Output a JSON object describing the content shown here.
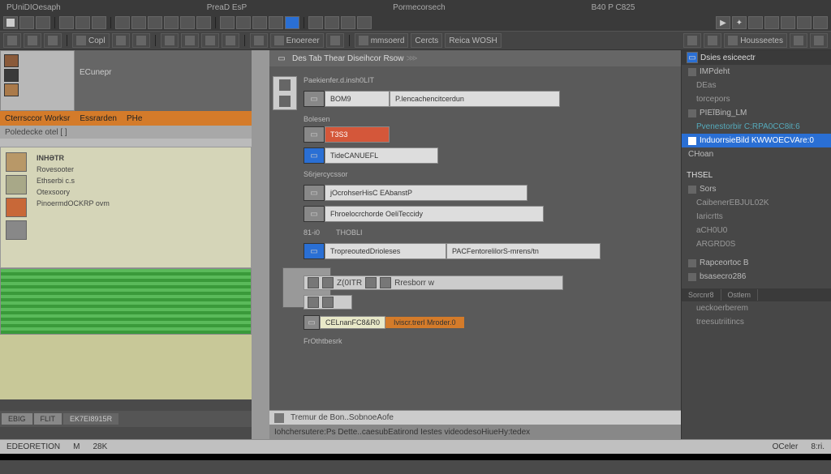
{
  "titlebar": {
    "app": "PUniDIOesaph",
    "mid": "PreaD EsP",
    "r1": "Pormecorsech",
    "r2": "B40 P C825"
  },
  "toolbar": {
    "copl": "Copl",
    "enoereer": "Enoereer",
    "mmsoerd": "mmsoerd",
    "cercts": "Cercts",
    "reica": "Reica WOSH",
    "housseetes": "Housseetes"
  },
  "left": {
    "panel2_title": "ECunepr",
    "orange": {
      "a": "Cterrsccor Worksr",
      "b": "Essrarden",
      "c": "PHe"
    },
    "gray": "Poledecke otel [ ]",
    "files": {
      "hdr": "INHƏTR",
      "items": [
        "Rovesooter",
        "Ethserbi c.s",
        "Otexsoory",
        "PinoermdOCKRP ovm"
      ]
    },
    "tabs": {
      "a": "EBIG",
      "b": "FLIT",
      "c": "EK7EI8915R"
    }
  },
  "mid": {
    "header": "Des Tab Thear Diseihcor Rsow",
    "lbl1": "Paekienfer.d.insh0LIT",
    "f1a": "BOM9",
    "f1b": "P.lencachencitcerdun",
    "lbl2": "Bolesen",
    "f2": "T3S3",
    "f3": "TideCANUEFL",
    "lbl3": "S6rjercycssor",
    "f4a": "jOcrohserHisC EAbanstP",
    "f4b": "Fhroelocrchorde OeliTeccidy",
    "lbl4": "81-i0",
    "lbl4b": "THOBLI",
    "f5a": "TropreoutedDrioleses",
    "f5b": "PACFentorelilorS-mrens/tn",
    "bar1": "Z(0ITR",
    "bar1b": "Rresborr w",
    "of1": "CELnanFC8&R0",
    "of2": "Iviscr.trerl Mroder.0",
    "lbl5": "FrOthtbesrk",
    "bot1": "Tremur de Bon..SobnoeAofe",
    "bot2": "Iohchersutere:Ps Dette..caesubEatirond Iestes videodesoHiueHy:tedex"
  },
  "right": {
    "hdr1": "Dsies esiceectr",
    "items1": [
      "IMPdeht",
      "DEas",
      "torcepors",
      "PIEĭBing_LM",
      "Pvenestorbir C:RPA0CC8it:6"
    ],
    "sel": "InduorrsieBild KWWOECVAre:0",
    "items2": [
      "CHoan"
    ],
    "hdr2": "THSEL",
    "items3": [
      "Sors",
      "CaibenerEBJUL02K",
      "Iaricrtts",
      "aCH0U0",
      "ARGRD0S"
    ],
    "items4": [
      "Rapceortoc B",
      "bsasecro286"
    ],
    "tabs": {
      "a": "Sorcnr8",
      "b": "Ostlem"
    },
    "items5": [
      "ueckoerberem",
      "treesutriitincs"
    ]
  },
  "status": {
    "a": "EDEORETION",
    "b": "M",
    "c": "28K",
    "r1": "OCeler",
    "r2": "8:ri."
  }
}
